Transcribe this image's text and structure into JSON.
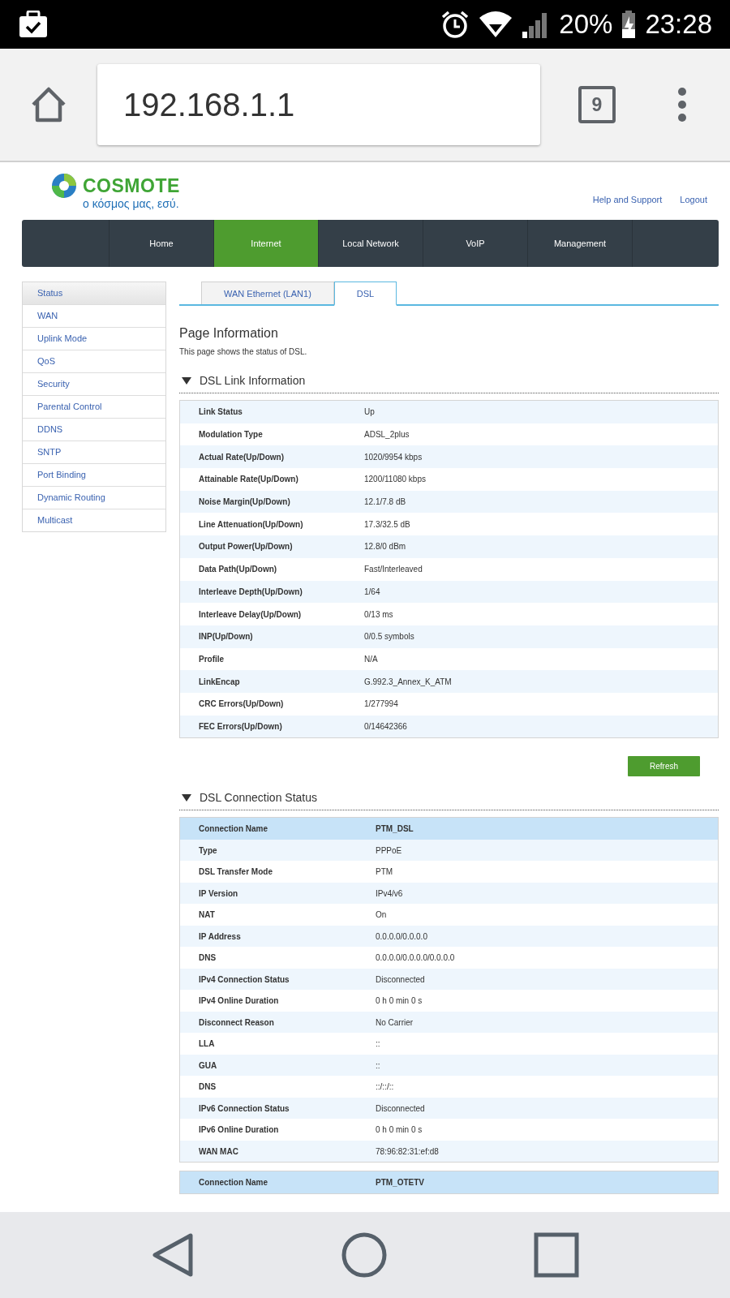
{
  "status_bar": {
    "battery": "20%",
    "time": "23:28"
  },
  "browser": {
    "url": "192.168.1.1",
    "tab_count": "9"
  },
  "header": {
    "brand": "COSMOTE",
    "tagline": "ο κόσμος μας, εσύ.",
    "links": [
      "Help and Support",
      "Logout"
    ]
  },
  "nav": [
    {
      "label": "Home",
      "selected": false
    },
    {
      "label": "Internet",
      "selected": true
    },
    {
      "label": "Local Network",
      "selected": false
    },
    {
      "label": "VoIP",
      "selected": false
    },
    {
      "label": "Management",
      "selected": false
    }
  ],
  "sidebar": [
    {
      "label": "Status",
      "selected": true
    },
    {
      "label": "WAN",
      "selected": false
    },
    {
      "label": "Uplink Mode",
      "selected": false
    },
    {
      "label": "QoS",
      "selected": false
    },
    {
      "label": "Security",
      "selected": false
    },
    {
      "label": "Parental Control",
      "selected": false
    },
    {
      "label": "DDNS",
      "selected": false
    },
    {
      "label": "SNTP",
      "selected": false
    },
    {
      "label": "Port Binding",
      "selected": false
    },
    {
      "label": "Dynamic Routing",
      "selected": false
    },
    {
      "label": "Multicast",
      "selected": false
    }
  ],
  "tabs": [
    {
      "label": "WAN Ethernet (LAN1)",
      "selected": false
    },
    {
      "label": "DSL",
      "selected": true
    }
  ],
  "page_info": {
    "title": "Page Information",
    "description": "This page shows the status of DSL."
  },
  "sections": [
    {
      "title": "DSL Link Information",
      "expanded": true,
      "tables": [
        {
          "rows": [
            {
              "kind": "row",
              "label": "Link Status",
              "value": "Up"
            },
            {
              "kind": "row",
              "label": "Modulation Type",
              "value": "ADSL_2plus"
            },
            {
              "kind": "row",
              "label": "Actual Rate(Up/Down)",
              "value": "1020/9954 kbps"
            },
            {
              "kind": "row",
              "label": "Attainable Rate(Up/Down)",
              "value": "1200/11080 kbps"
            },
            {
              "kind": "row",
              "label": "Noise Margin(Up/Down)",
              "value": "12.1/7.8 dB"
            },
            {
              "kind": "row",
              "label": "Line Attenuation(Up/Down)",
              "value": "17.3/32.5 dB"
            },
            {
              "kind": "row",
              "label": "Output Power(Up/Down)",
              "value": "12.8/0 dBm"
            },
            {
              "kind": "row",
              "label": "Data Path(Up/Down)",
              "value": "Fast/Interleaved"
            },
            {
              "kind": "row",
              "label": "Interleave Depth(Up/Down)",
              "value": "1/64"
            },
            {
              "kind": "row",
              "label": "Interleave Delay(Up/Down)",
              "value": "0/13 ms"
            },
            {
              "kind": "row",
              "label": "INP(Up/Down)",
              "value": "0/0.5 symbols"
            },
            {
              "kind": "row",
              "label": "Profile",
              "value": "N/A"
            },
            {
              "kind": "row",
              "label": "LinkEncap",
              "value": "G.992.3_Annex_K_ATM"
            },
            {
              "kind": "row",
              "label": "CRC Errors(Up/Down)",
              "value": "1/277994"
            },
            {
              "kind": "row",
              "label": "FEC Errors(Up/Down)",
              "value": "0/14642366"
            }
          ]
        }
      ],
      "button": "Refresh"
    },
    {
      "title": "DSL Connection Status",
      "expanded": true,
      "tables": [
        {
          "rows": [
            {
              "kind": "header",
              "label": "Connection Name",
              "value": "PTM_DSL"
            },
            {
              "kind": "row",
              "label": "Type",
              "value": "PPPoE"
            },
            {
              "kind": "row",
              "label": "DSL Transfer Mode",
              "value": "PTM"
            },
            {
              "kind": "row",
              "label": "IP Version",
              "value": "IPv4/v6"
            },
            {
              "kind": "row",
              "label": "NAT",
              "value": "On"
            },
            {
              "kind": "row",
              "label": "IP Address",
              "value": "0.0.0.0/0.0.0.0"
            },
            {
              "kind": "row",
              "label": "DNS",
              "value": "0.0.0.0/0.0.0.0/0.0.0.0"
            },
            {
              "kind": "row",
              "label": "IPv4 Connection Status",
              "value": "Disconnected"
            },
            {
              "kind": "row",
              "label": "IPv4 Online Duration",
              "value": "0 h 0 min 0 s"
            },
            {
              "kind": "row",
              "label": "Disconnect Reason",
              "value": "No Carrier"
            },
            {
              "kind": "row",
              "label": "LLA",
              "value": "::"
            },
            {
              "kind": "row",
              "label": "GUA",
              "value": "::"
            },
            {
              "kind": "row",
              "label": "DNS",
              "value": "::/::/::"
            },
            {
              "kind": "row",
              "label": "IPv6 Connection Status",
              "value": "Disconnected"
            },
            {
              "kind": "row",
              "label": "IPv6 Online Duration",
              "value": "0 h 0 min 0 s"
            },
            {
              "kind": "row",
              "label": "WAN MAC",
              "value": "78:96:82:31:ef:d8"
            }
          ]
        },
        {
          "rows": [
            {
              "kind": "header",
              "label": "Connection Name",
              "value": "PTM_OTETV"
            }
          ]
        }
      ]
    }
  ]
}
